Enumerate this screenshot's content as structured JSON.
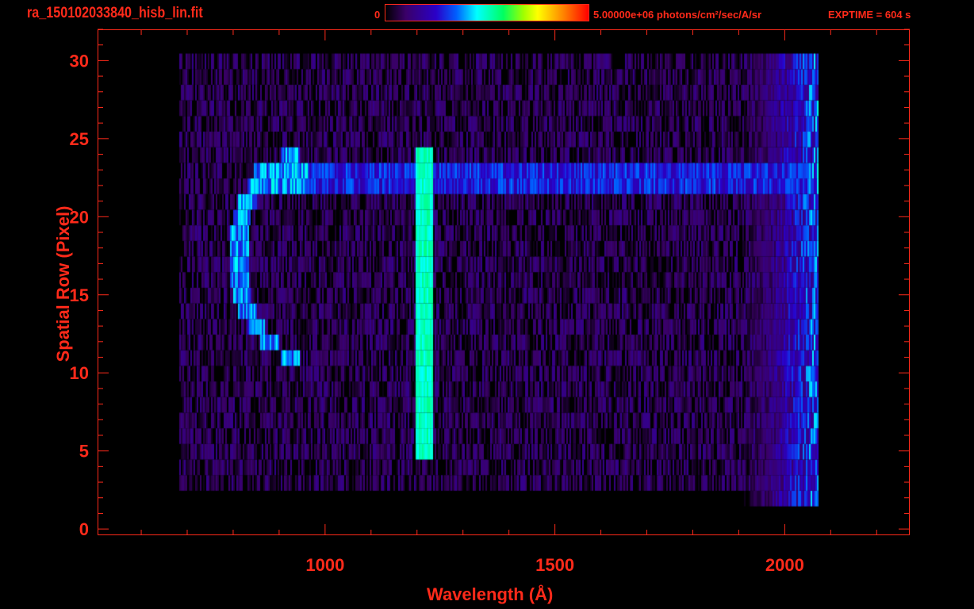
{
  "header": {
    "title": "ra_150102033840_hisb_lin.fit",
    "colorbar_min": "0",
    "colorbar_max": "5.00000e+06 photons/cm²/sec/A/sr",
    "exptime": "EXPTIME = 604 s"
  },
  "chart_data": {
    "type": "heatmap",
    "title": "ra_150102033840_hisb_lin.fit",
    "xlabel": "Wavelength (Å)",
    "ylabel": "Spatial Row (Pixel)",
    "xlim": [
      505,
      2272
    ],
    "ylim": [
      -0.4,
      32
    ],
    "xticks": [
      1000,
      1500,
      2000
    ],
    "xtick_labels": [
      "1000",
      "1500",
      "2000"
    ],
    "yticks": [
      0,
      5,
      10,
      15,
      20,
      25,
      30
    ],
    "ytick_labels": [
      "0",
      "5",
      "10",
      "15",
      "20",
      "25",
      "30"
    ],
    "colorbar": {
      "min": 0,
      "max": 5000000,
      "units": "photons/cm2/sec/A/sr"
    },
    "features": [
      {
        "name": "background",
        "x": [
          680,
          2070
        ],
        "rows": [
          3,
          30
        ],
        "level": 0.1
      },
      {
        "name": "red-end-noise",
        "x": [
          1900,
          2070
        ],
        "rows": [
          2,
          30
        ],
        "level": 0.32
      },
      {
        "name": "lyman-alpha-line",
        "x": [
          1195,
          1230
        ],
        "rows": [
          5,
          24
        ],
        "level": 0.5
      },
      {
        "name": "horizontal-band",
        "x": [
          840,
          2070
        ],
        "rows": [
          22,
          23
        ],
        "level": 0.28
      },
      {
        "name": "arc",
        "x": [
          790,
          960
        ],
        "rows": [
          11,
          24
        ],
        "level": 0.38
      }
    ]
  }
}
